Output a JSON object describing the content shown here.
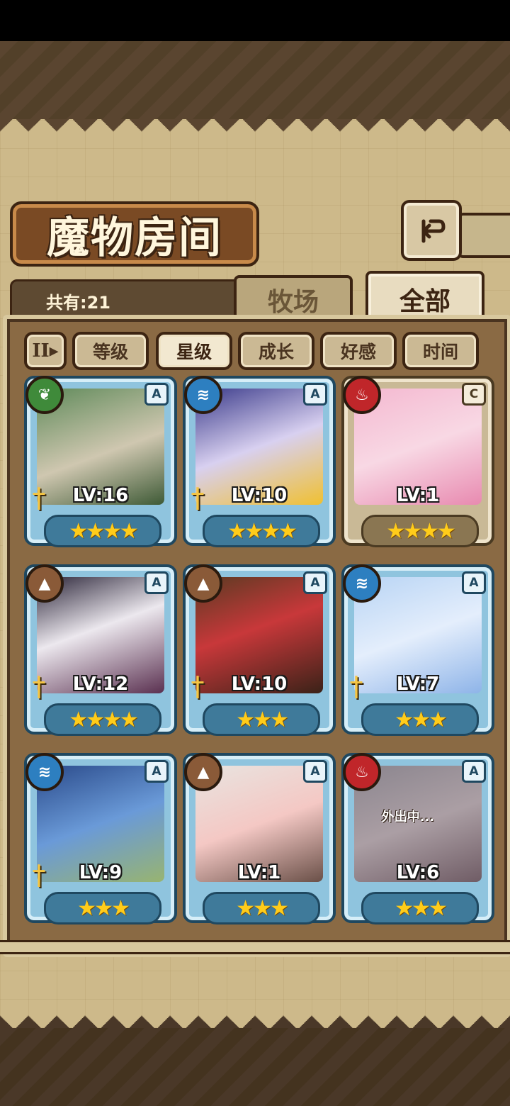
{
  "header": {
    "title": "魔物房间",
    "back_icon": "return-arrow-icon"
  },
  "count": {
    "label": "共有:21"
  },
  "tabs": [
    {
      "label": "牧场",
      "active": false
    },
    {
      "label": "全部",
      "active": true
    }
  ],
  "sort": {
    "toggle_icon": "II▸",
    "options": [
      {
        "label": "等级",
        "active": false
      },
      {
        "label": "星级",
        "active": true
      },
      {
        "label": "成长",
        "active": false
      },
      {
        "label": "好感",
        "active": false
      },
      {
        "label": "时间",
        "active": false
      }
    ]
  },
  "monsters": [
    {
      "level": "LV:16",
      "rank": "A",
      "element": "grass",
      "stars": "★★★★",
      "weapon": true,
      "status": ""
    },
    {
      "level": "LV:10",
      "rank": "A",
      "element": "water",
      "stars": "★★★★",
      "weapon": true,
      "status": ""
    },
    {
      "level": "LV:1",
      "rank": "C",
      "element": "fire",
      "stars": "★★★★",
      "weapon": false,
      "status": ""
    },
    {
      "level": "LV:12",
      "rank": "A",
      "element": "earth",
      "stars": "★★★★",
      "weapon": true,
      "status": ""
    },
    {
      "level": "LV:10",
      "rank": "A",
      "element": "earth",
      "stars": "★★★",
      "weapon": true,
      "status": ""
    },
    {
      "level": "LV:7",
      "rank": "A",
      "element": "water",
      "stars": "★★★",
      "weapon": true,
      "status": ""
    },
    {
      "level": "LV:9",
      "rank": "A",
      "element": "water",
      "stars": "★★★",
      "weapon": true,
      "status": ""
    },
    {
      "level": "LV:1",
      "rank": "A",
      "element": "earth",
      "stars": "★★★",
      "weapon": false,
      "status": ""
    },
    {
      "level": "LV:6",
      "rank": "A",
      "element": "fire",
      "stars": "★★★",
      "weapon": false,
      "status": "外出中..."
    }
  ],
  "colors": {
    "frame_blue": "#8fc4de",
    "frame_dark": "#1f4860",
    "star": "#ffcc1a",
    "parchment": "#cdb98a",
    "wood": "#7a4a24"
  }
}
